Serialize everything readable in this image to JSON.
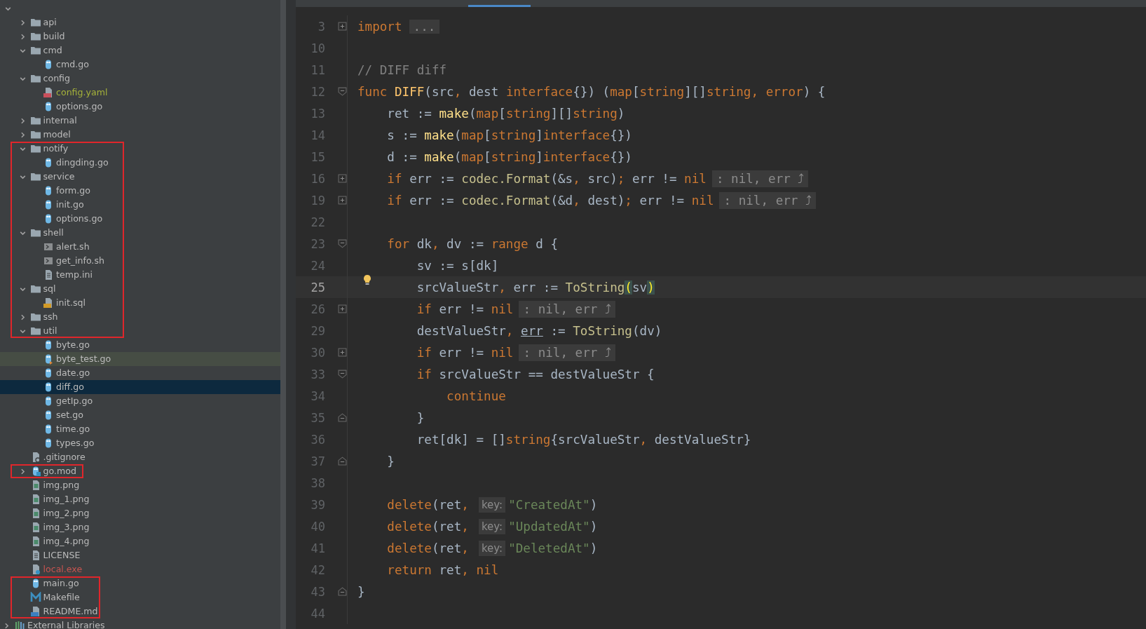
{
  "tree": [
    {
      "name": "api",
      "kind": "folder",
      "expanded": false,
      "selected": false,
      "highlighted": false,
      "boxed": false
    },
    {
      "name": "build",
      "kind": "folder",
      "expanded": false,
      "selected": false,
      "highlighted": false,
      "boxed": false
    },
    {
      "name": "cmd",
      "kind": "folder",
      "expanded": true,
      "selected": false,
      "highlighted": false,
      "boxed": false,
      "children": [
        {
          "name": "cmd.go",
          "kind": "go",
          "selected": false,
          "highlighted": false,
          "boxed": false
        }
      ]
    },
    {
      "name": "config",
      "kind": "folder",
      "expanded": true,
      "selected": false,
      "highlighted": false,
      "boxed": false,
      "children": [
        {
          "name": "config.yaml",
          "kind": "yaml",
          "selected": false,
          "highlighted": false,
          "boxed": false,
          "color": "#a5b23a"
        },
        {
          "name": "options.go",
          "kind": "go",
          "selected": false,
          "highlighted": false,
          "boxed": false
        }
      ]
    },
    {
      "name": "internal",
      "kind": "folder",
      "expanded": false,
      "selected": false,
      "highlighted": false,
      "boxed": false
    },
    {
      "name": "model",
      "kind": "folder",
      "expanded": false,
      "selected": false,
      "highlighted": false,
      "boxed": false
    },
    {
      "name": "notify",
      "kind": "folder",
      "expanded": true,
      "selected": false,
      "highlighted": false,
      "boxed": true,
      "children": [
        {
          "name": "dingding.go",
          "kind": "go",
          "selected": false,
          "highlighted": false,
          "boxed": true
        }
      ]
    },
    {
      "name": "service",
      "kind": "folder",
      "expanded": true,
      "selected": false,
      "highlighted": false,
      "boxed": true,
      "children": [
        {
          "name": "form.go",
          "kind": "go",
          "selected": false,
          "highlighted": false,
          "boxed": true
        },
        {
          "name": "init.go",
          "kind": "go",
          "selected": false,
          "highlighted": false,
          "boxed": true
        },
        {
          "name": "options.go",
          "kind": "go",
          "selected": false,
          "highlighted": false,
          "boxed": true
        }
      ]
    },
    {
      "name": "shell",
      "kind": "folder",
      "expanded": true,
      "selected": false,
      "highlighted": false,
      "boxed": true,
      "children": [
        {
          "name": "alert.sh",
          "kind": "shell",
          "selected": false,
          "highlighted": false,
          "boxed": true
        },
        {
          "name": "get_info.sh",
          "kind": "shell",
          "selected": false,
          "highlighted": false,
          "boxed": true
        },
        {
          "name": "temp.ini",
          "kind": "text",
          "selected": false,
          "highlighted": false,
          "boxed": true
        }
      ]
    },
    {
      "name": "sql",
      "kind": "folder",
      "expanded": true,
      "selected": false,
      "highlighted": false,
      "boxed": true,
      "children": [
        {
          "name": "init.sql",
          "kind": "sql",
          "selected": false,
          "highlighted": false,
          "boxed": true
        }
      ]
    },
    {
      "name": "ssh",
      "kind": "folder",
      "expanded": false,
      "selected": false,
      "highlighted": false,
      "boxed": true
    },
    {
      "name": "util",
      "kind": "folder",
      "expanded": true,
      "selected": false,
      "highlighted": false,
      "boxed": true,
      "children": [
        {
          "name": "byte.go",
          "kind": "go",
          "selected": false,
          "highlighted": false,
          "boxed": false
        },
        {
          "name": "byte_test.go",
          "kind": "gotest",
          "selected": false,
          "highlighted": true,
          "boxed": false
        },
        {
          "name": "date.go",
          "kind": "go",
          "selected": false,
          "highlighted": false,
          "boxed": false
        },
        {
          "name": "diff.go",
          "kind": "go",
          "selected": true,
          "highlighted": false,
          "boxed": false
        },
        {
          "name": "getIp.go",
          "kind": "go",
          "selected": false,
          "highlighted": false,
          "boxed": false
        },
        {
          "name": "set.go",
          "kind": "go",
          "selected": false,
          "highlighted": false,
          "boxed": false
        },
        {
          "name": "time.go",
          "kind": "go",
          "selected": false,
          "highlighted": false,
          "boxed": false
        },
        {
          "name": "types.go",
          "kind": "go",
          "selected": false,
          "highlighted": false,
          "boxed": false
        }
      ]
    },
    {
      "name": ".gitignore",
      "kind": "ignore",
      "selected": false,
      "highlighted": false,
      "boxed": false
    },
    {
      "name": "go.mod",
      "kind": "gomod",
      "expanded": false,
      "selected": false,
      "highlighted": false,
      "boxed": true
    },
    {
      "name": "img.png",
      "kind": "image",
      "selected": false,
      "highlighted": false,
      "boxed": false
    },
    {
      "name": "img_1.png",
      "kind": "image",
      "selected": false,
      "highlighted": false,
      "boxed": false
    },
    {
      "name": "img_2.png",
      "kind": "image",
      "selected": false,
      "highlighted": false,
      "boxed": false
    },
    {
      "name": "img_3.png",
      "kind": "image",
      "selected": false,
      "highlighted": false,
      "boxed": false
    },
    {
      "name": "img_4.png",
      "kind": "image",
      "selected": false,
      "highlighted": false,
      "boxed": false
    },
    {
      "name": "LICENSE",
      "kind": "text",
      "selected": false,
      "highlighted": false,
      "boxed": false
    },
    {
      "name": "local.exe",
      "kind": "exe",
      "selected": false,
      "highlighted": false,
      "boxed": false,
      "color": "#c75450"
    },
    {
      "name": "main.go",
      "kind": "go",
      "selected": false,
      "highlighted": false,
      "boxed": true
    },
    {
      "name": "Makefile",
      "kind": "makefile",
      "selected": false,
      "highlighted": false,
      "boxed": true
    },
    {
      "name": "README.md",
      "kind": "markdown",
      "selected": false,
      "highlighted": false,
      "boxed": true
    }
  ],
  "external_libraries": {
    "name": "External Libraries",
    "expanded": false
  },
  "lines": [
    {
      "number": "3",
      "current": false,
      "fold": {
        "kind": "collapsed"
      },
      "tokens": [
        {
          "text": "import",
          "kind": "kw"
        },
        {
          "text": "...",
          "kind": "folded"
        }
      ]
    },
    {
      "number": "10",
      "current": false
    },
    {
      "number": "11",
      "current": false,
      "tokens": [
        {
          "text": "// DIFF diff",
          "kind": "comment"
        }
      ]
    },
    {
      "number": "12",
      "current": false,
      "fold": {
        "kind": "start"
      },
      "tokens": [
        {
          "text": "func",
          "kind": "kw"
        },
        {
          "text": " DIFF",
          "kind": "fn"
        },
        {
          "text": "(src",
          "kind": "id"
        },
        {
          "text": ",",
          "kind": "punct"
        },
        {
          "text": " dest ",
          "kind": "id"
        },
        {
          "text": "interface",
          "kind": "kw"
        },
        {
          "text": "{}) (",
          "kind": "id"
        },
        {
          "text": "map",
          "kind": "kw"
        },
        {
          "text": "[",
          "kind": "id"
        },
        {
          "text": "string",
          "kind": "kw"
        },
        {
          "text": "][]",
          "kind": "id"
        },
        {
          "text": "string",
          "kind": "kw"
        },
        {
          "text": ", error",
          "kind": "kw"
        },
        {
          "text": ") {",
          "kind": "id"
        }
      ]
    },
    {
      "number": "13",
      "current": false,
      "tokens": [
        {
          "text": "    ret := ",
          "kind": "id"
        },
        {
          "text": "make",
          "kind": "builtin"
        },
        {
          "text": "(",
          "kind": "id"
        },
        {
          "text": "map",
          "kind": "kw"
        },
        {
          "text": "[",
          "kind": "id"
        },
        {
          "text": "string",
          "kind": "kw"
        },
        {
          "text": "][]",
          "kind": "id"
        },
        {
          "text": "string",
          "kind": "kw"
        },
        {
          "text": ")",
          "kind": "id"
        }
      ]
    },
    {
      "number": "14",
      "current": false,
      "tokens": [
        {
          "text": "    s := ",
          "kind": "id"
        },
        {
          "text": "make",
          "kind": "builtin"
        },
        {
          "text": "(",
          "kind": "id"
        },
        {
          "text": "map",
          "kind": "kw"
        },
        {
          "text": "[",
          "kind": "id"
        },
        {
          "text": "string",
          "kind": "kw"
        },
        {
          "text": "]",
          "kind": "id"
        },
        {
          "text": "interface",
          "kind": "kw"
        },
        {
          "text": "{})",
          "kind": "id"
        }
      ]
    },
    {
      "number": "15",
      "current": false,
      "tokens": [
        {
          "text": "    d := ",
          "kind": "id"
        },
        {
          "text": "make",
          "kind": "builtin"
        },
        {
          "text": "(",
          "kind": "id"
        },
        {
          "text": "map",
          "kind": "kw"
        },
        {
          "text": "[",
          "kind": "id"
        },
        {
          "text": "string",
          "kind": "kw"
        },
        {
          "text": "]",
          "kind": "id"
        },
        {
          "text": "interface",
          "kind": "kw"
        },
        {
          "text": "{})",
          "kind": "id"
        }
      ]
    },
    {
      "number": "16",
      "current": false,
      "fold": {
        "kind": "collapsed"
      },
      "tokens": [
        {
          "text": "    if",
          "kind": "kw"
        },
        {
          "text": " err := ",
          "kind": "id"
        },
        {
          "text": "codec.Format",
          "kind": "call"
        },
        {
          "text": "(&s",
          "kind": "id"
        },
        {
          "text": ",",
          "kind": "punct"
        },
        {
          "text": " src)",
          "kind": "id"
        },
        {
          "text": ";",
          "kind": "punct"
        },
        {
          "text": " err != ",
          "kind": "id"
        },
        {
          "text": "nil",
          "kind": "kw"
        },
        {
          "text": ": nil, err ⤴",
          "kind": "hint"
        }
      ]
    },
    {
      "number": "19",
      "current": false,
      "fold": {
        "kind": "collapsed"
      },
      "tokens": [
        {
          "text": "    if",
          "kind": "kw"
        },
        {
          "text": " err := ",
          "kind": "id"
        },
        {
          "text": "codec.Format",
          "kind": "call"
        },
        {
          "text": "(&d",
          "kind": "id"
        },
        {
          "text": ",",
          "kind": "punct"
        },
        {
          "text": " dest)",
          "kind": "id"
        },
        {
          "text": ";",
          "kind": "punct"
        },
        {
          "text": " err != ",
          "kind": "id"
        },
        {
          "text": "nil",
          "kind": "kw"
        },
        {
          "text": ": nil, err ⤴",
          "kind": "hint"
        }
      ]
    },
    {
      "number": "22",
      "current": false
    },
    {
      "number": "23",
      "current": false,
      "fold": {
        "kind": "start"
      },
      "tokens": [
        {
          "text": "    for",
          "kind": "kw"
        },
        {
          "text": " dk",
          "kind": "id"
        },
        {
          "text": ",",
          "kind": "punct"
        },
        {
          "text": " dv := ",
          "kind": "id"
        },
        {
          "text": "range",
          "kind": "kw"
        },
        {
          "text": " d {",
          "kind": "id"
        }
      ]
    },
    {
      "number": "24",
      "current": false,
      "tokens": [
        {
          "text": "        sv := s[dk]",
          "kind": "id"
        }
      ]
    },
    {
      "number": "25",
      "current": true,
      "tokens": [
        {
          "text": "        srcValueStr",
          "kind": "id"
        },
        {
          "text": ",",
          "kind": "punct"
        },
        {
          "text": " err := ",
          "kind": "id"
        },
        {
          "text": "ToString",
          "kind": "call"
        },
        {
          "text": "(",
          "kind": "brace"
        },
        {
          "text": "sv",
          "kind": "id"
        },
        {
          "text": ")",
          "kind": "brace"
        }
      ]
    },
    {
      "number": "26",
      "current": false,
      "fold": {
        "kind": "collapsed"
      },
      "tokens": [
        {
          "text": "        if",
          "kind": "kw"
        },
        {
          "text": " err != ",
          "kind": "id"
        },
        {
          "text": "nil",
          "kind": "kw"
        },
        {
          "text": ": nil, err ⤴",
          "kind": "hint"
        }
      ]
    },
    {
      "number": "29",
      "current": false,
      "tokens": [
        {
          "text": "        destValueStr",
          "kind": "id"
        },
        {
          "text": ", ",
          "kind": "punct"
        },
        {
          "text": "err",
          "kind": "underlined"
        },
        {
          "text": " := ",
          "kind": "id"
        },
        {
          "text": "ToString",
          "kind": "call"
        },
        {
          "text": "(dv)",
          "kind": "id"
        }
      ]
    },
    {
      "number": "30",
      "current": false,
      "fold": {
        "kind": "collapsed"
      },
      "tokens": [
        {
          "text": "        if",
          "kind": "kw"
        },
        {
          "text": " err != ",
          "kind": "id"
        },
        {
          "text": "nil",
          "kind": "kw"
        },
        {
          "text": ": nil, err ⤴",
          "kind": "hint"
        }
      ]
    },
    {
      "number": "33",
      "current": false,
      "fold": {
        "kind": "start"
      },
      "tokens": [
        {
          "text": "        if",
          "kind": "kw"
        },
        {
          "text": " srcValueStr == destValueStr {",
          "kind": "id"
        }
      ]
    },
    {
      "number": "34",
      "current": false,
      "tokens": [
        {
          "text": "            continue",
          "kind": "kw"
        }
      ]
    },
    {
      "number": "35",
      "current": false,
      "fold": {
        "kind": "end"
      },
      "tokens": [
        {
          "text": "        }",
          "kind": "id"
        }
      ]
    },
    {
      "number": "36",
      "current": false,
      "tokens": [
        {
          "text": "        ret[dk] = []",
          "kind": "id"
        },
        {
          "text": "string",
          "kind": "kw"
        },
        {
          "text": "{srcValueStr",
          "kind": "id"
        },
        {
          "text": ",",
          "kind": "punct"
        },
        {
          "text": " destValueStr}",
          "kind": "id"
        }
      ]
    },
    {
      "number": "37",
      "current": false,
      "fold": {
        "kind": "end"
      },
      "tokens": [
        {
          "text": "    }",
          "kind": "id"
        }
      ]
    },
    {
      "number": "38",
      "current": false
    },
    {
      "number": "39",
      "current": false,
      "tokens": [
        {
          "text": "    delete",
          "kind": "kw"
        },
        {
          "text": "(ret",
          "kind": "id"
        },
        {
          "text": ",",
          "kind": "punct"
        },
        {
          "text": "key:",
          "kind": "param"
        },
        {
          "text": "\"CreatedAt\"",
          "kind": "str"
        },
        {
          "text": ")",
          "kind": "id"
        }
      ]
    },
    {
      "number": "40",
      "current": false,
      "tokens": [
        {
          "text": "    delete",
          "kind": "kw"
        },
        {
          "text": "(ret",
          "kind": "id"
        },
        {
          "text": ",",
          "kind": "punct"
        },
        {
          "text": "key:",
          "kind": "param"
        },
        {
          "text": "\"UpdatedAt\"",
          "kind": "str"
        },
        {
          "text": ")",
          "kind": "id"
        }
      ]
    },
    {
      "number": "41",
      "current": false,
      "tokens": [
        {
          "text": "    delete",
          "kind": "kw"
        },
        {
          "text": "(ret",
          "kind": "id"
        },
        {
          "text": ",",
          "kind": "punct"
        },
        {
          "text": "key:",
          "kind": "param"
        },
        {
          "text": "\"DeletedAt\"",
          "kind": "str"
        },
        {
          "text": ")",
          "kind": "id"
        }
      ]
    },
    {
      "number": "42",
      "current": false,
      "tokens": [
        {
          "text": "    return",
          "kind": "kw"
        },
        {
          "text": " ret",
          "kind": "id"
        },
        {
          "text": ", ",
          "kind": "punct"
        },
        {
          "text": "nil",
          "kind": "kw"
        }
      ]
    },
    {
      "number": "43",
      "current": false,
      "fold": {
        "kind": "end"
      },
      "tokens": [
        {
          "text": "}",
          "kind": "id"
        }
      ]
    },
    {
      "number": "44",
      "current": false
    }
  ]
}
